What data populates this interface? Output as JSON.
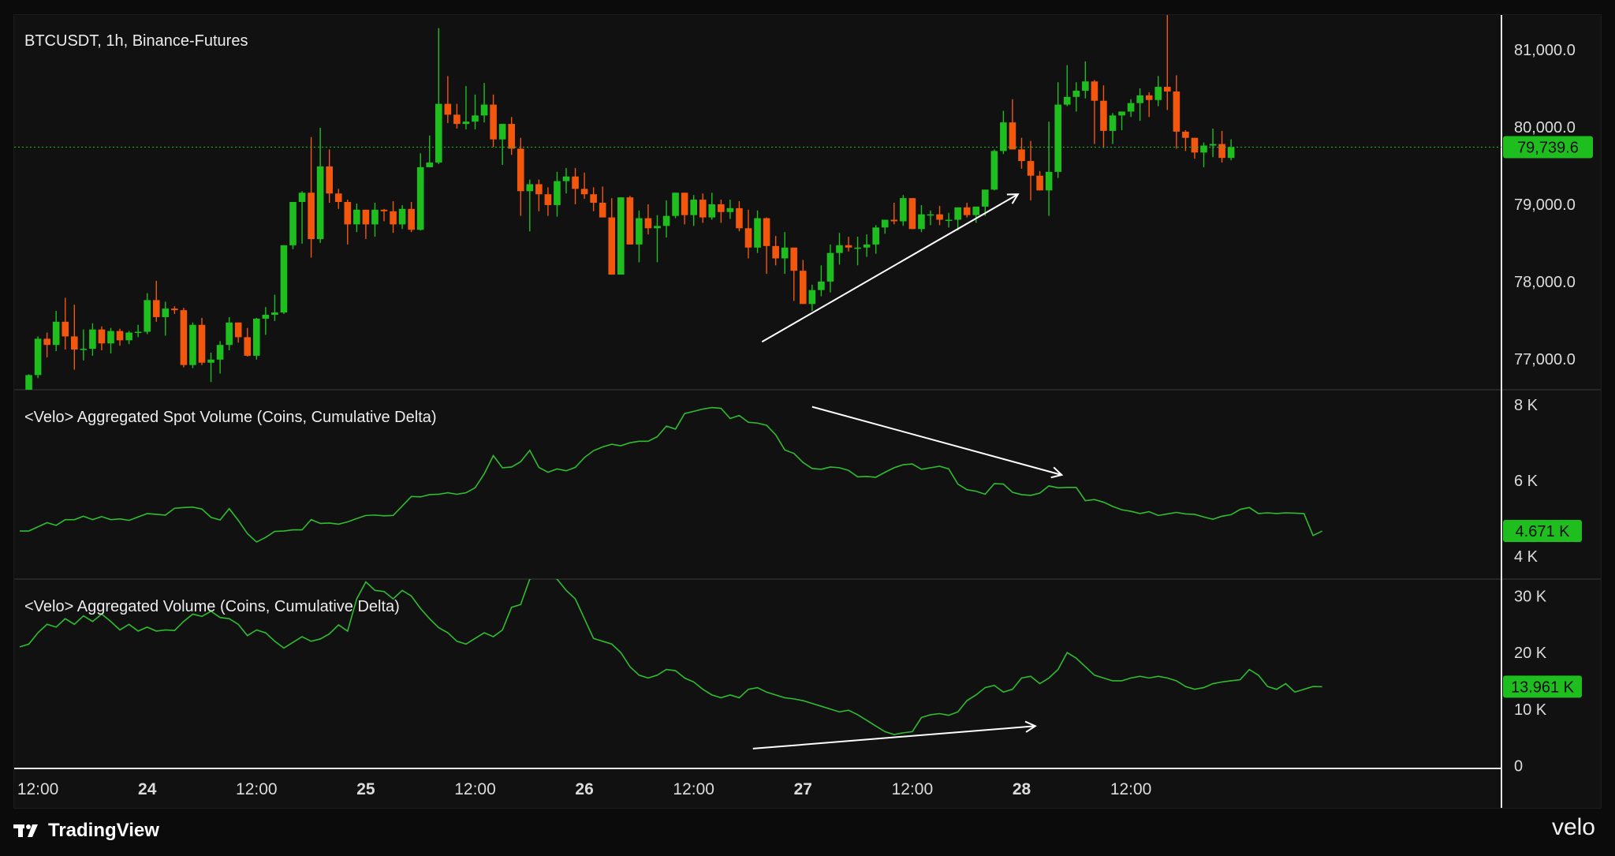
{
  "chart_data": [
    {
      "type": "candlestick",
      "title": "BTCUSDT, 1h, Binance-Futures",
      "x_start": "23 10:00",
      "x_interval_hours": 1,
      "y_ticks": [
        "81,000.0",
        "80,000.0",
        "79,000.0",
        "78,000.0",
        "77,000.0"
      ],
      "ylim": [
        76600,
        81450
      ],
      "last_price": "79,739.6",
      "last_value": 79739.6,
      "colors": {
        "up": "#1fbe1f",
        "down": "#f2570d"
      },
      "ohlc": [
        [
          76530,
          76590,
          76480,
          76560
        ],
        [
          76560,
          76800,
          76550,
          76790
        ],
        [
          76790,
          77290,
          76750,
          77260
        ],
        [
          77260,
          77340,
          77020,
          77180
        ],
        [
          77180,
          77620,
          77100,
          77480
        ],
        [
          77480,
          77790,
          77120,
          77290
        ],
        [
          77290,
          77700,
          76860,
          77120
        ],
        [
          77120,
          77380,
          76980,
          77130
        ],
        [
          77130,
          77460,
          77040,
          77380
        ],
        [
          77380,
          77420,
          77110,
          77200
        ],
        [
          77200,
          77400,
          77070,
          77360
        ],
        [
          77360,
          77390,
          77170,
          77240
        ],
        [
          77240,
          77360,
          77190,
          77340
        ],
        [
          77340,
          77440,
          77280,
          77350
        ],
        [
          77350,
          77850,
          77320,
          77760
        ],
        [
          77760,
          78010,
          77480,
          77540
        ],
        [
          77540,
          77740,
          77300,
          77650
        ],
        [
          77650,
          77680,
          77580,
          77630
        ],
        [
          77630,
          77660,
          76890,
          76920
        ],
        [
          76920,
          77470,
          76880,
          77440
        ],
        [
          77440,
          77530,
          76920,
          76950
        ],
        [
          76950,
          77080,
          76700,
          76990
        ],
        [
          76990,
          77230,
          76810,
          77180
        ],
        [
          77180,
          77540,
          77110,
          77470
        ],
        [
          77470,
          77450,
          77210,
          77280
        ],
        [
          77280,
          77400,
          77030,
          77040
        ],
        [
          77040,
          77530,
          76990,
          77520
        ],
        [
          77520,
          77670,
          77310,
          77570
        ],
        [
          77570,
          77830,
          77490,
          77600
        ],
        [
          77600,
          78190,
          77580,
          78470
        ],
        [
          78470,
          78810,
          78420,
          79030
        ],
        [
          79030,
          79170,
          78490,
          79150
        ],
        [
          79150,
          79870,
          78310,
          78550
        ],
        [
          78550,
          79990,
          78500,
          79490
        ],
        [
          79490,
          79710,
          79020,
          79140
        ],
        [
          79140,
          79200,
          78940,
          79030
        ],
        [
          79030,
          79060,
          78480,
          78740
        ],
        [
          78740,
          79010,
          78640,
          78930
        ],
        [
          78930,
          78910,
          78550,
          78740
        ],
        [
          78740,
          79020,
          78580,
          78930
        ],
        [
          78930,
          78940,
          78780,
          78910
        ],
        [
          78910,
          79040,
          78630,
          78740
        ],
        [
          78740,
          78990,
          78680,
          78940
        ],
        [
          78940,
          79030,
          78640,
          78670
        ],
        [
          78670,
          79660,
          78660,
          79480
        ],
        [
          79480,
          79890,
          79520,
          79540
        ],
        [
          79540,
          81280,
          79520,
          80300
        ],
        [
          80300,
          80660,
          80050,
          80160
        ],
        [
          80160,
          80300,
          79980,
          80040
        ],
        [
          80040,
          80530,
          79970,
          80070
        ],
        [
          80070,
          80420,
          79970,
          80150
        ],
        [
          80150,
          80570,
          80060,
          80290
        ],
        [
          80290,
          80420,
          79740,
          79840
        ],
        [
          79840,
          80000,
          79510,
          80040
        ],
        [
          80040,
          80130,
          79640,
          79720
        ],
        [
          79720,
          79860,
          78850,
          79170
        ],
        [
          79170,
          79320,
          78650,
          79260
        ],
        [
          79260,
          79320,
          78910,
          79130
        ],
        [
          79130,
          79220,
          78850,
          78990
        ],
        [
          78990,
          79420,
          78840,
          79300
        ],
        [
          79300,
          79470,
          79140,
          79360
        ],
        [
          79360,
          79470,
          79000,
          79200
        ],
        [
          79200,
          79410,
          79070,
          79130
        ],
        [
          79130,
          79220,
          78910,
          79020
        ],
        [
          79020,
          79230,
          78870,
          78830
        ],
        [
          78830,
          79080,
          78090,
          78090
        ],
        [
          78090,
          79090,
          78090,
          79090
        ],
        [
          79090,
          79110,
          78480,
          78480
        ],
        [
          78480,
          78920,
          78250,
          78820
        ],
        [
          78820,
          79000,
          78610,
          78690
        ],
        [
          78690,
          78860,
          78250,
          78720
        ],
        [
          78720,
          79050,
          78570,
          78850
        ],
        [
          78850,
          79050,
          78820,
          79150
        ],
        [
          79150,
          79120,
          78740,
          78860
        ],
        [
          78860,
          79120,
          78720,
          79060
        ],
        [
          79060,
          79140,
          78760,
          78830
        ],
        [
          78830,
          79150,
          78800,
          79000
        ],
        [
          79000,
          79060,
          78760,
          78900
        ],
        [
          78900,
          79060,
          78810,
          78950
        ],
        [
          78950,
          79040,
          78650,
          78690
        ],
        [
          78690,
          78930,
          78300,
          78440
        ],
        [
          78440,
          78920,
          78370,
          78820
        ],
        [
          78820,
          78830,
          78100,
          78460
        ],
        [
          78460,
          78590,
          78210,
          78300
        ],
        [
          78300,
          78640,
          78100,
          78440
        ],
        [
          78440,
          78280,
          77750,
          78140
        ],
        [
          78140,
          78280,
          77750,
          77710
        ],
        [
          77710,
          77960,
          77620,
          77890
        ],
        [
          77890,
          78210,
          77810,
          78000
        ],
        [
          78000,
          78480,
          77860,
          78370
        ],
        [
          78370,
          78630,
          78220,
          78470
        ],
        [
          78470,
          78580,
          78390,
          78440
        ],
        [
          78440,
          78580,
          78210,
          78440
        ],
        [
          78440,
          78610,
          78320,
          78480
        ],
        [
          78480,
          78730,
          78360,
          78700
        ],
        [
          78700,
          78790,
          78620,
          78800
        ],
        [
          78800,
          79020,
          78740,
          78780
        ],
        [
          78780,
          79120,
          78720,
          79080
        ],
        [
          79080,
          79060,
          78690,
          78680
        ],
        [
          78680,
          78990,
          78640,
          78870
        ],
        [
          78870,
          78920,
          78730,
          78870
        ],
        [
          78870,
          78980,
          78730,
          78800
        ],
        [
          78800,
          78890,
          78700,
          78800
        ],
        [
          78800,
          78950,
          78660,
          78960
        ],
        [
          78960,
          79020,
          78830,
          78860
        ],
        [
          78860,
          78970,
          78760,
          78970
        ],
        [
          78970,
          79000,
          78850,
          79190
        ],
        [
          79190,
          79710,
          79180,
          79690
        ],
        [
          79690,
          80210,
          79650,
          80060
        ],
        [
          80060,
          80360,
          79840,
          79710
        ],
        [
          79710,
          79860,
          79460,
          79560
        ],
        [
          79560,
          79820,
          79050,
          79370
        ],
        [
          79370,
          79430,
          79300,
          79180
        ],
        [
          79180,
          80070,
          78850,
          79420
        ],
        [
          79420,
          80580,
          79340,
          80290
        ],
        [
          80290,
          80800,
          80270,
          80390
        ],
        [
          80390,
          80580,
          80200,
          80470
        ],
        [
          80470,
          80850,
          80370,
          80590
        ],
        [
          80590,
          80610,
          79780,
          80340
        ],
        [
          80340,
          80540,
          79730,
          79950
        ],
        [
          79950,
          80180,
          79780,
          80150
        ],
        [
          80150,
          80100,
          79960,
          80200
        ],
        [
          80200,
          80360,
          80130,
          80310
        ],
        [
          80310,
          80500,
          80080,
          80410
        ],
        [
          80410,
          80450,
          80130,
          80350
        ],
        [
          80350,
          80660,
          80270,
          80520
        ],
        [
          80520,
          81480,
          80220,
          80460
        ],
        [
          80460,
          80670,
          79720,
          79940
        ],
        [
          79940,
          79960,
          79690,
          79860
        ],
        [
          79860,
          79810,
          79590,
          79670
        ],
        [
          79670,
          79800,
          79480,
          79760
        ],
        [
          79760,
          79980,
          79610,
          79780
        ],
        [
          79780,
          79950,
          79540,
          79600
        ],
        [
          79600,
          79840,
          79570,
          79740
        ]
      ]
    },
    {
      "type": "line",
      "title": "<Velo> Aggregated Spot Volume (Coins, Cumulative Delta)",
      "y_ticks": [
        "8 K",
        "6 K",
        "4 K"
      ],
      "ylim": [
        3400,
        8400
      ],
      "last_value_label": "4.671 K",
      "last_value": 4671,
      "color": "#2ebd2e",
      "values": [
        4670,
        4670,
        4780,
        4890,
        4820,
        4970,
        4970,
        5060,
        4970,
        5050,
        4970,
        4990,
        4950,
        5040,
        5130,
        5110,
        5090,
        5270,
        5290,
        5300,
        5250,
        5030,
        4960,
        5260,
        4950,
        4600,
        4380,
        4500,
        4660,
        4670,
        4700,
        4700,
        4970,
        4870,
        4880,
        4850,
        4910,
        5000,
        5080,
        5090,
        5070,
        5080,
        5330,
        5580,
        5570,
        5630,
        5640,
        5680,
        5640,
        5680,
        5810,
        6180,
        6660,
        6340,
        6360,
        6500,
        6800,
        6350,
        6220,
        6310,
        6260,
        6350,
        6610,
        6790,
        6890,
        6960,
        6920,
        7000,
        7040,
        7040,
        7160,
        7440,
        7360,
        7770,
        7830,
        7890,
        7930,
        7910,
        7640,
        7720,
        7540,
        7520,
        7460,
        7210,
        6810,
        6720,
        6480,
        6320,
        6300,
        6360,
        6340,
        6270,
        6100,
        6110,
        6090,
        6220,
        6340,
        6420,
        6440,
        6300,
        6340,
        6380,
        6310,
        5910,
        5760,
        5720,
        5640,
        5920,
        5910,
        5690,
        5630,
        5610,
        5670,
        5860,
        5810,
        5820,
        5820,
        5470,
        5500,
        5430,
        5320,
        5230,
        5190,
        5130,
        5180,
        5080,
        5120,
        5160,
        5120,
        5110,
        5040,
        4980,
        5060,
        5100,
        5240,
        5290,
        5130,
        5150,
        5130,
        5150,
        5140,
        5130,
        4550,
        4670
      ]
    },
    {
      "type": "line",
      "title": "<Velo> Aggregated Volume (Coins, Cumulative Delta)",
      "y_ticks": [
        "30 K",
        "20 K",
        "10 K",
        "0"
      ],
      "ylim": [
        -500,
        33000
      ],
      "last_value_label": "13.961 K",
      "last_value": 13961,
      "color": "#2ebd2e",
      "values": [
        21000,
        21500,
        23500,
        25000,
        24500,
        26000,
        25000,
        26500,
        25500,
        26800,
        25500,
        24000,
        25000,
        23800,
        24500,
        23800,
        24000,
        23900,
        25500,
        26800,
        26400,
        27300,
        26200,
        26000,
        25000,
        23000,
        24000,
        23500,
        22000,
        20800,
        21800,
        22800,
        22000,
        22400,
        23300,
        24900,
        23800,
        29500,
        32500,
        31000,
        30800,
        29500,
        31000,
        30000,
        27800,
        26000,
        24400,
        23500,
        22000,
        21500,
        22500,
        23500,
        22800,
        24000,
        28000,
        28500,
        33000,
        33500,
        33500,
        33000,
        31000,
        29500,
        26000,
        22500,
        22000,
        21500,
        20000,
        17500,
        16000,
        15500,
        16000,
        17000,
        16800,
        15500,
        14800,
        13500,
        12500,
        12000,
        12500,
        12000,
        13500,
        13800,
        13000,
        12500,
        12000,
        11800,
        11500,
        11000,
        10500,
        10000,
        9500,
        9800,
        9000,
        8000,
        7000,
        6000,
        5500,
        5800,
        6000,
        8500,
        9000,
        9200,
        8900,
        9500,
        11500,
        12500,
        13800,
        14200,
        13000,
        13500,
        15500,
        15800,
        14500,
        15500,
        17000,
        20000,
        19000,
        17500,
        16000,
        15500,
        15000,
        15000,
        15500,
        15800,
        15500,
        15800,
        15500,
        15000,
        14000,
        13500,
        13800,
        14500,
        14800,
        15000,
        15200,
        17000,
        16000,
        14000,
        13500,
        14500,
        13000,
        13500,
        14000,
        13961
      ]
    }
  ],
  "time_axis": {
    "ticks": [
      {
        "label": "12:00",
        "bold": false
      },
      {
        "label": "24",
        "bold": true
      },
      {
        "label": "12:00",
        "bold": false
      },
      {
        "label": "25",
        "bold": true
      },
      {
        "label": "12:00",
        "bold": false
      },
      {
        "label": "26",
        "bold": true
      },
      {
        "label": "12:00",
        "bold": false
      },
      {
        "label": "27",
        "bold": true
      },
      {
        "label": "12:00",
        "bold": false
      },
      {
        "label": "28",
        "bold": true
      },
      {
        "label": "12:00",
        "bold": false
      }
    ]
  },
  "footer": {
    "brand": "TradingView",
    "partner": "velo"
  }
}
